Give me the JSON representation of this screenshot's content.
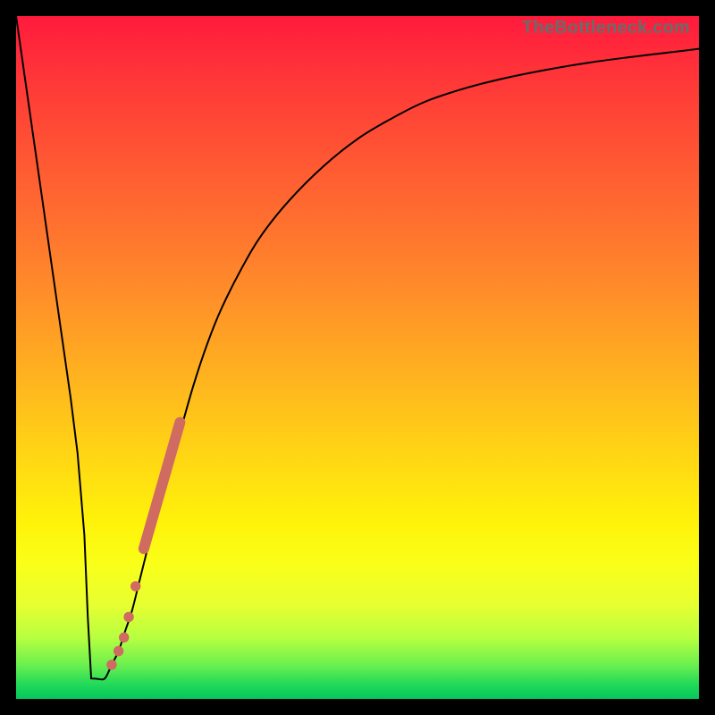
{
  "watermark": "TheBottleneck.com",
  "colors": {
    "frame": "#000000",
    "curve": "#000000",
    "markers": "#cf6b61"
  },
  "chart_data": {
    "type": "line",
    "title": "",
    "xlabel": "",
    "ylabel": "",
    "xlim": [
      0,
      100
    ],
    "ylim": [
      0,
      100
    ],
    "grid": false,
    "legend": false,
    "curve_x": [
      0,
      2,
      4,
      6,
      7,
      8,
      9,
      10,
      10.5,
      11,
      12,
      13,
      14,
      15,
      16,
      17,
      18,
      19,
      20,
      22,
      24,
      26,
      28,
      30,
      33,
      36,
      40,
      45,
      50,
      55,
      60,
      66,
      72,
      78,
      84,
      90,
      95,
      100
    ],
    "curve_y": [
      100,
      86,
      72,
      58,
      51,
      44,
      36,
      24,
      12,
      3,
      3,
      3,
      5,
      7,
      10,
      13,
      17,
      21,
      25,
      32,
      39,
      46,
      52,
      57,
      63,
      68,
      73,
      78,
      82,
      85,
      87.5,
      89.5,
      91,
      92.2,
      93.2,
      94,
      94.6,
      95.2
    ],
    "markers": {
      "segment": {
        "x1": 18.7,
        "y1": 22.0,
        "x2": 24.0,
        "y2": 40.5
      },
      "dots": [
        {
          "x": 14.0,
          "y": 5.0
        },
        {
          "x": 15.0,
          "y": 7.0
        },
        {
          "x": 15.8,
          "y": 9.0
        },
        {
          "x": 16.5,
          "y": 12.0
        },
        {
          "x": 17.5,
          "y": 16.5
        }
      ]
    }
  }
}
